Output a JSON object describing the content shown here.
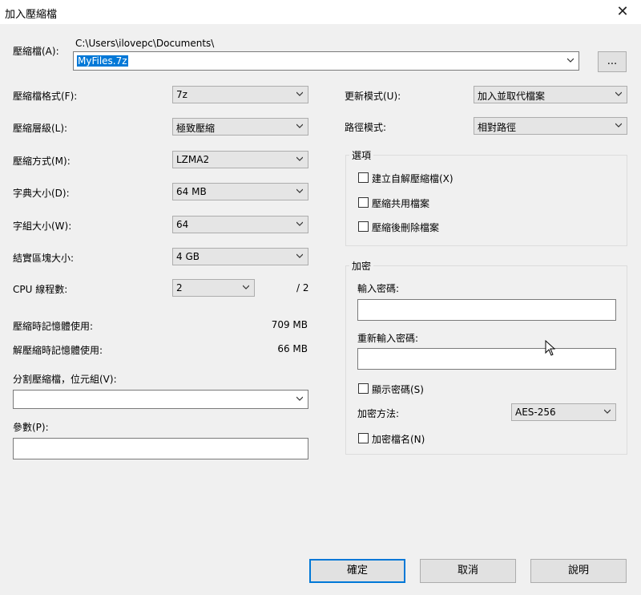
{
  "window": {
    "title": "加入壓縮檔",
    "close_glyph": "✕"
  },
  "archive": {
    "label": "壓縮檔(A):",
    "path": "C:\\Users\\ilovepc\\Documents\\",
    "filename": "MyFiles.7z",
    "browse_label": "..."
  },
  "left": {
    "format": {
      "label": "壓縮檔格式(F):",
      "value": "7z"
    },
    "level": {
      "label": "壓縮層級(L):",
      "value": "極致壓縮"
    },
    "method": {
      "label": "壓縮方式(M):",
      "value": "LZMA2"
    },
    "dict": {
      "label": "字典大小(D):",
      "value": "64 MB"
    },
    "word": {
      "label": "字組大小(W):",
      "value": "64"
    },
    "solid": {
      "label": "結實區塊大小:",
      "value": "4 GB"
    },
    "cpu": {
      "label": "CPU 線程數:",
      "value": "2",
      "max": "/ 2"
    },
    "mem_compress": {
      "label": "壓縮時記憶體使用:",
      "value": "709 MB"
    },
    "mem_decompress": {
      "label": "解壓縮時記憶體使用:",
      "value": "66 MB"
    },
    "split": {
      "label": "分割壓縮檔，位元組(V):",
      "value": ""
    },
    "params": {
      "label": "參數(P):",
      "value": ""
    }
  },
  "right": {
    "update": {
      "label": "更新模式(U):",
      "value": "加入並取代檔案"
    },
    "pathmode": {
      "label": "路徑模式:",
      "value": "相對路徑"
    },
    "options": {
      "title": "選項",
      "sfx": "建立自解壓縮檔(X)",
      "shared": "壓縮共用檔案",
      "delete": "壓縮後刪除檔案"
    },
    "encryption": {
      "title": "加密",
      "pwd_label": "輸入密碼:",
      "pwd2_label": "重新輸入密碼:",
      "show_pwd": "顯示密碼(S)",
      "method_label": "加密方法:",
      "method_value": "AES-256",
      "encrypt_names": "加密檔名(N)"
    }
  },
  "buttons": {
    "ok": "確定",
    "cancel": "取消",
    "help": "說明"
  }
}
